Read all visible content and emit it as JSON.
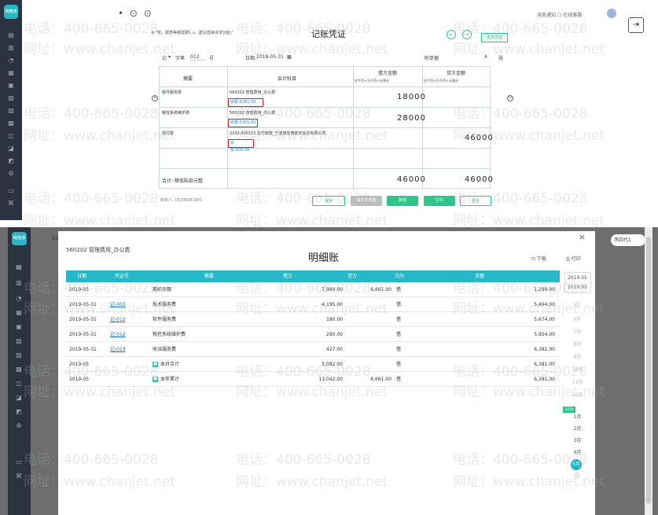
{
  "watermark": {
    "phone": "电话：400-665-0028",
    "site": "网址：www.chanjet.net"
  },
  "top": {
    "logo_text": "畅捷通",
    "nav_dots": "• ⊙ ⊙",
    "breadcrumb": "⊕ \"账，报表等都需要1.x，建议直接请求功能)\"",
    "title": "记账凭证",
    "green_button": "更多凭证",
    "user_links": "消息通知 ☐ 在线客服",
    "meta": {
      "type": "记",
      "no_label": "字第",
      "no_value": "012",
      "no_suffix": "号",
      "date_label": "日期:",
      "date_value": "2018-05-31",
      "attachment_label": "附单据",
      "attachment_count": "4",
      "attachment_suffix": "张"
    },
    "headers": {
      "summary": "摘要",
      "account": "会计科目",
      "debit": "借方金额",
      "credit": "贷方金额",
      "digits": "亿千百十万千百十元角分"
    },
    "rows": [
      {
        "summary": "软件服务费",
        "account": "560202 管理费用_办公费",
        "balance": "余额:5381.00",
        "debit": "18000",
        "credit": ""
      },
      {
        "summary": "税控系统维护费",
        "account": "560202 管理费用_办公费",
        "balance": "余额:5381.00",
        "debit": "28000",
        "credit": ""
      },
      {
        "summary": "现付款",
        "account": "2202.000115 应付账款_宁波景信倚航天信息有限公司",
        "balance": "余额:600.00",
        "debit": "",
        "credit": "46000"
      }
    ],
    "total_label": "合计: 肆佰陆拾元整",
    "total_debit": "46000",
    "total_credit": "46000",
    "maker_label": "制单人: 18208081801",
    "buttons": {
      "save_draft": "保存",
      "save_new": "保存并新增",
      "add": "新增",
      "print": "打印",
      "more": "更多"
    }
  },
  "bottom": {
    "tab_number": "20",
    "account_name": "560202 管理费用_办公费",
    "title": "明细账",
    "close": "×",
    "download": "⊡ 下载",
    "print": "⎙ 打印",
    "right_button": "李四代1",
    "columns": [
      "日期",
      "凭证号",
      "摘要",
      "借方",
      "贷方",
      "方向",
      "余额"
    ],
    "rows": [
      {
        "date": "2019-05",
        "voucher": "",
        "summary": "期初余额",
        "debit": "7,960.00",
        "credit": "6,661.00",
        "dir": "借",
        "balance": "1,299.00",
        "marker": false
      },
      {
        "date": "2019-05-31",
        "voucher": "记-003",
        "summary": "技术服务费",
        "debit": "4,195.00",
        "credit": "",
        "dir": "借",
        "balance": "5,494.00",
        "marker": false
      },
      {
        "date": "2019-05-31",
        "voucher": "记-012",
        "summary": "软件服务费",
        "debit": "180.00",
        "credit": "",
        "dir": "借",
        "balance": "5,674.00",
        "marker": false
      },
      {
        "date": "2019-05-31",
        "voucher": "记-012",
        "summary": "税控系统维护费",
        "debit": "280.00",
        "credit": "",
        "dir": "借",
        "balance": "5,954.00",
        "marker": false
      },
      {
        "date": "2019-05-31",
        "voucher": "记-013",
        "summary": "收派服务费",
        "debit": "427.00",
        "credit": "",
        "dir": "借",
        "balance": "6,381.00",
        "marker": false
      },
      {
        "date": "2019-05",
        "voucher": "",
        "summary": "本月合计",
        "debit": "5,082.00",
        "credit": "",
        "dir": "借",
        "balance": "6,381.00",
        "marker": true
      },
      {
        "date": "2019-05",
        "voucher": "",
        "summary": "本年累计",
        "debit": "13,042.00",
        "credit": "6,661.00",
        "dir": "借",
        "balance": "6,381.00",
        "marker": true
      }
    ],
    "date_panel": {
      "range_start": "2019.05",
      "range_end": "2019.05",
      "faint_months": [
        "6月",
        "7月",
        "8月",
        "9月",
        "10月",
        "11月",
        "12月"
      ],
      "year_badge": "2019",
      "months": [
        "1月",
        "2月",
        "3月",
        "4月"
      ],
      "active": "5月"
    }
  },
  "colors": {
    "teal": "#27b7c6",
    "green": "#31c48d",
    "sidebar": "#2b3341",
    "red_box": "#e02020"
  }
}
